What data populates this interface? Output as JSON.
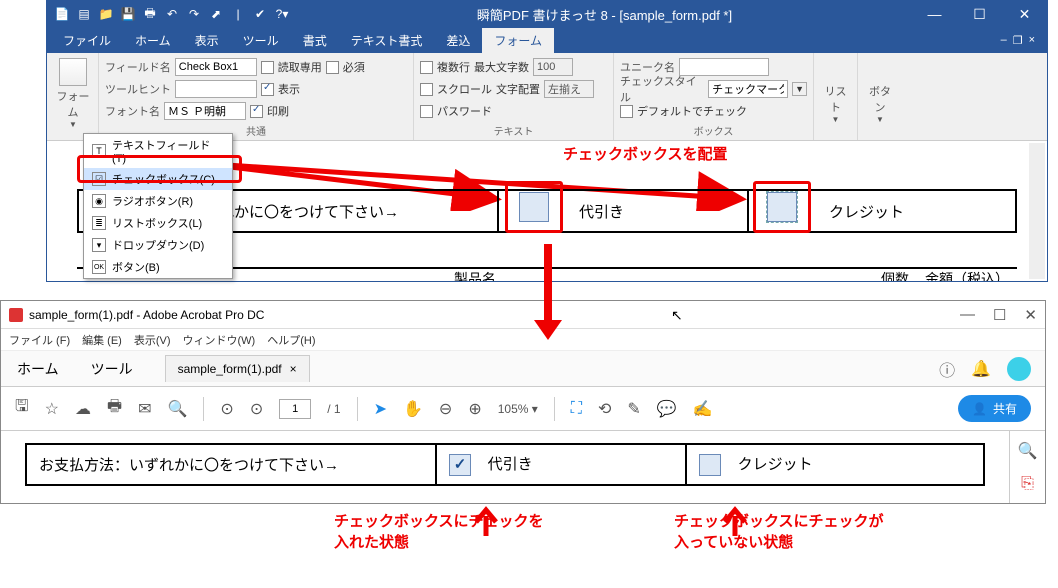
{
  "app1": {
    "title": "瞬簡PDF 書けまっせ 8 - [sample_form.pdf *]",
    "menu": [
      "ファイル",
      "ホーム",
      "表示",
      "ツール",
      "書式",
      "テキスト書式",
      "差込",
      "フォーム"
    ],
    "active_menu": 7,
    "ribbon": {
      "form_label": "フォーム",
      "field_name_label": "フィールド名",
      "field_name_value": "Check Box1",
      "tooltip_label": "ツールヒント",
      "tooltip_value": "",
      "font_label": "フォント名",
      "font_value": "ＭＳ Ｐ明朝",
      "readonly": "読取専用",
      "required": "必須",
      "visible": "表示",
      "print": "印刷",
      "common_label": "共通",
      "multiline": "複数行",
      "maxchars_label": "最大文字数",
      "maxchars_value": "100",
      "scroll": "スクロール",
      "align_label": "文字配置",
      "align_value": "左揃え",
      "password": "パスワード",
      "text_label": "テキスト",
      "unique_label": "ユニーク名",
      "unique_value": "",
      "checkstyle_label": "チェックスタイル",
      "checkstyle_value": "チェックマーク",
      "default_check": "デフォルトでチェック",
      "box_label": "ボックス",
      "list_btn": "リスト",
      "button_btn": "ボタン"
    },
    "dropdown": {
      "items": [
        {
          "icon": "T",
          "label": "テキストフィールド(T)"
        },
        {
          "icon": "☑",
          "label": "チェックボックス(C)"
        },
        {
          "icon": "◉",
          "label": "ラジオボタン(R)"
        },
        {
          "icon": "≣",
          "label": "リストボックス(L)"
        },
        {
          "icon": "▾",
          "label": "ドロップダウン(D)"
        },
        {
          "icon": "OK",
          "label": "ボタン(B)"
        }
      ],
      "selected": 1
    },
    "annotation": "チェックボックスを配置",
    "doc": {
      "row_lead": "れかに〇をつけて下さい→",
      "opt1": "代引き",
      "opt2": "クレジット",
      "col1": "製品名",
      "col2": "個数",
      "col3": "金額（税込）"
    }
  },
  "app2": {
    "title": "sample_form(1).pdf - Adobe Acrobat Pro DC",
    "menu": [
      "ファイル (F)",
      "編集 (E)",
      "表示(V)",
      "ウィンドウ(W)",
      "ヘルプ(H)"
    ],
    "tabs": {
      "home": "ホーム",
      "tool": "ツール",
      "file": "sample_form(1).pdf"
    },
    "toolbar": {
      "page_cur": "1",
      "page_total": "/  1",
      "zoom": "105%",
      "share": "共有"
    },
    "doc": {
      "lead": "お支払方法：いずれかに〇をつけて下さい→",
      "opt1": "代引き",
      "opt2": "クレジット",
      "check1": "✓",
      "check2": ""
    }
  },
  "captions": {
    "c1a": "チェックボックスにチェックを",
    "c1b": "入れた状態",
    "c2a": "チェックボックスにチェックが",
    "c2b": "入っていない状態"
  }
}
